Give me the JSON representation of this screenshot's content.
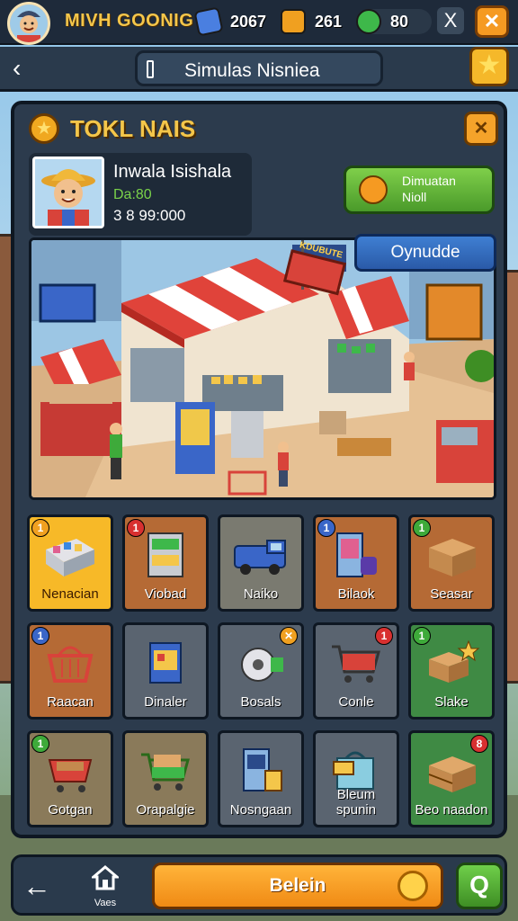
{
  "header": {
    "player_name": "MIVH GOONIG",
    "resources": [
      {
        "icon": "blue-gem-icon",
        "value": "2067",
        "color": "#4a7fe0"
      },
      {
        "icon": "gold-bar-icon",
        "value": "261",
        "color": "#f0a020"
      },
      {
        "icon": "green-cash-icon",
        "value": "80",
        "color": "#3eb84a"
      }
    ],
    "close_label": "X",
    "close_orange_label": "✕"
  },
  "titlebar": {
    "back_glyph": "‹",
    "title": "Simulas Nisniea",
    "star_glyph": "★"
  },
  "panel": {
    "title": "TOKL NAIS",
    "star_glyph": "★",
    "tool_glyph": "✕",
    "profile": {
      "name": "Inwala Isishala",
      "level": "Da:80",
      "money": "3 8  99:000"
    },
    "green_button": {
      "line1": "Dimuatan",
      "line2": "Nioll"
    },
    "blue_button": "Oynudde",
    "scene_signs": {
      "store_sign": "KDUBUTE",
      "flag": ""
    }
  },
  "grid": [
    {
      "label": "Nenacian",
      "badge": "1",
      "badge_side": "l",
      "badge_color": "#f0a020",
      "bg": "#f7b928",
      "art": "crate",
      "selected": true
    },
    {
      "label": "Viobad",
      "badge": "1",
      "badge_side": "l",
      "badge_color": "#d83030",
      "bg": "#b56a35",
      "art": "shelf"
    },
    {
      "label": "Naiko",
      "badge": "",
      "badge_side": "l",
      "badge_color": "",
      "bg": "#7a7a70",
      "art": "van"
    },
    {
      "label": "Bilaok",
      "badge": "1",
      "badge_side": "l",
      "badge_color": "#3a66c8",
      "bg": "#b56a35",
      "art": "vending"
    },
    {
      "label": "Seasar",
      "badge": "1",
      "badge_side": "l",
      "badge_color": "#3eaa3a",
      "bg": "#b56a35",
      "art": "box"
    },
    {
      "label": "Raacan",
      "badge": "1",
      "badge_side": "l",
      "badge_color": "#3a66c8",
      "bg": "#b56a35",
      "art": "basket"
    },
    {
      "label": "Dinaler",
      "badge": "",
      "badge_side": "l",
      "badge_color": "",
      "bg": "#5a6470",
      "art": "cooler"
    },
    {
      "label": "Bosals",
      "badge": "",
      "badge_side": "l",
      "badge_color": "",
      "bg": "#5a6470",
      "art": "roll"
    },
    {
      "label": "Conle",
      "badge": "1",
      "badge_side": "r",
      "badge_color": "#d83030",
      "bg": "#5a6470",
      "art": "cart"
    },
    {
      "label": "Slake",
      "badge": "1",
      "badge_side": "l",
      "badge_color": "#3eaa3a",
      "bg": "#3f8a44",
      "art": "box-star"
    },
    {
      "label": "Gotgan",
      "badge": "1",
      "badge_side": "l",
      "badge_color": "#3eaa3a",
      "bg": "#8a7a5a",
      "art": "red-cart"
    },
    {
      "label": "Orapalgie",
      "badge": "",
      "badge_side": "l",
      "badge_color": "",
      "bg": "#8a7a5a",
      "art": "green-cart"
    },
    {
      "label": "Nosngaan",
      "badge": "",
      "badge_side": "l",
      "badge_color": "",
      "bg": "#5a6470",
      "art": "kiosk"
    },
    {
      "label": "Bleum spunin",
      "badge": "",
      "badge_side": "l",
      "badge_color": "",
      "bg": "#5a6470",
      "art": "bag"
    },
    {
      "label": "Beo naadon",
      "badge": "8",
      "badge_side": "r",
      "badge_color": "#d83030",
      "bg": "#3f8a44",
      "art": "boxes"
    }
  ],
  "bottombar": {
    "back_glyph": "←",
    "home_label": "Vaes",
    "main_label": "Belein",
    "search_glyph": "Q"
  }
}
